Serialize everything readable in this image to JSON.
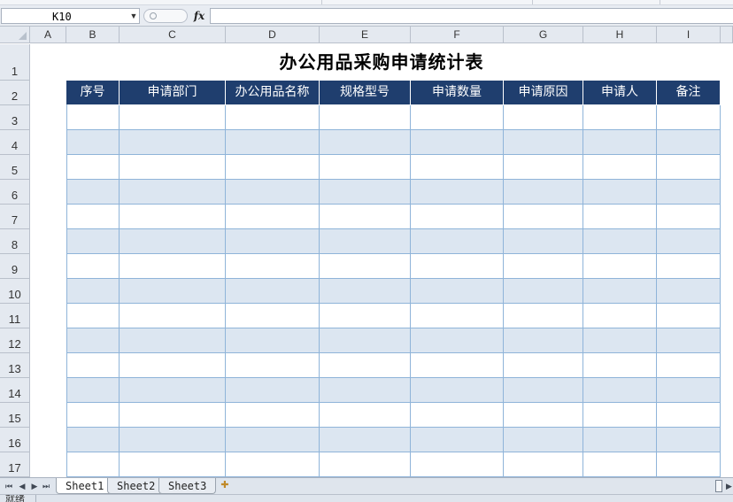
{
  "name_box": {
    "value": "K10"
  },
  "formula_bar": {
    "fx_label": "fx",
    "value": ""
  },
  "columns": [
    "A",
    "B",
    "C",
    "D",
    "E",
    "F",
    "G",
    "H",
    "I"
  ],
  "rows": [
    "1",
    "2",
    "3",
    "4",
    "5",
    "6",
    "7",
    "8",
    "9",
    "10",
    "11",
    "12",
    "13",
    "14",
    "15",
    "16",
    "17"
  ],
  "sheet": {
    "title": "办公用品采购申请统计表",
    "table_headers": [
      "序号",
      "申请部门",
      "办公用品名称",
      "规格型号",
      "申请数量",
      "申请原因",
      "申请人",
      "备注"
    ]
  },
  "sheet_tabs": [
    "Sheet1",
    "Sheet2",
    "Sheet3"
  ],
  "active_sheet": "Sheet1",
  "status": {
    "text": "就绪"
  },
  "colors": {
    "header_fill": "#1f3e6e",
    "band_fill": "#dce6f1",
    "grid_line": "#8fb4d9"
  }
}
